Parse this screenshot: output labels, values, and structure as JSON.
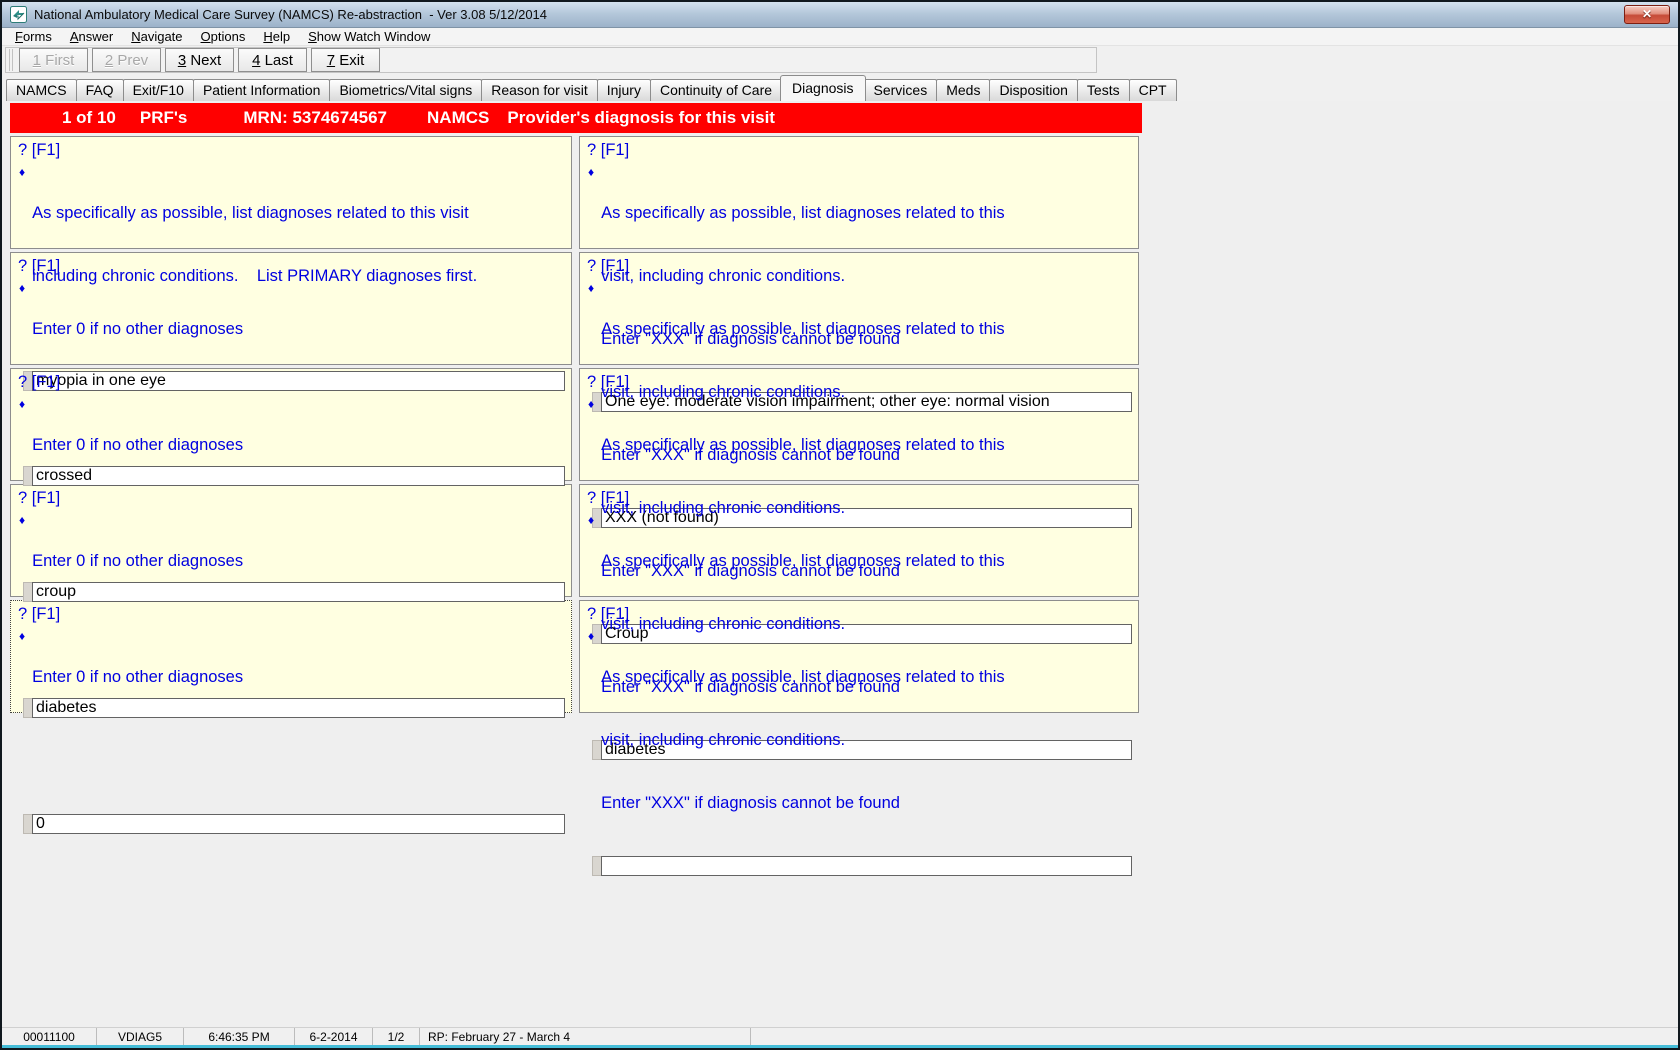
{
  "window": {
    "title": "National Ambulatory Medical Care Survey (NAMCS) Re-abstraction  - Ver 3.08 5/12/2014"
  },
  "icons": {
    "close": "✕",
    "bullet": "♦",
    "app": "app-logo"
  },
  "colors": {
    "banner_bg": "#FF0000",
    "banner_text": "#FFFFFF",
    "panel_bg": "#FFFFE1",
    "instruction_text": "#0000E0",
    "close_button": "#C64B38",
    "titlebar": "#B5C8DB"
  },
  "menu": {
    "items": [
      {
        "key": "F",
        "rest": "orms"
      },
      {
        "key": "A",
        "rest": "nswer"
      },
      {
        "key": "N",
        "rest": "avigate"
      },
      {
        "key": "O",
        "rest": "ptions"
      },
      {
        "key": "H",
        "rest": "elp"
      },
      {
        "key": "S",
        "rest": "how Watch Window"
      }
    ]
  },
  "toolbar": {
    "buttons": [
      {
        "key": "1",
        "rest": " First",
        "disabled": true
      },
      {
        "key": "2",
        "rest": " Prev",
        "disabled": true
      },
      {
        "key": "3",
        "rest": " Next",
        "disabled": false
      },
      {
        "key": "4",
        "rest": " Last",
        "disabled": false
      },
      {
        "key": "7",
        "rest": " Exit",
        "disabled": false
      }
    ]
  },
  "tabs": {
    "active": "Diagnosis",
    "items": [
      "NAMCS",
      "FAQ",
      "Exit/F10",
      "Patient Information",
      "Biometrics/Vital signs",
      "Reason for visit",
      "Injury",
      "Continuity of Care",
      "Diagnosis",
      "Services",
      "Meds",
      "Disposition",
      "Tests",
      "CPT"
    ]
  },
  "banner": {
    "position": "1 of 10",
    "group": "PRF's",
    "mrn": "MRN: 5374674567",
    "survey": "NAMCS",
    "title": "Provider's diagnosis for this visit"
  },
  "panels": {
    "left": [
      {
        "help": "? [F1]",
        "lines": [
          "As specifically as possible, list diagnoses related to this visit",
          "including chronic conditions.    List PRIMARY diagnoses first."
        ],
        "value": "myopia in one eye"
      },
      {
        "help": "? [F1]",
        "lines": [
          "Enter 0 if no other diagnoses"
        ],
        "value": "crossed"
      },
      {
        "help": "? [F1]",
        "lines": [
          "Enter 0 if no other diagnoses"
        ],
        "value": "croup"
      },
      {
        "help": "? [F1]",
        "lines": [
          "Enter 0 if no other diagnoses"
        ],
        "value": "diabetes"
      },
      {
        "help": "? [F1]",
        "lines": [
          "Enter 0 if no other diagnoses"
        ],
        "value": "0"
      }
    ],
    "right": [
      {
        "help": "? [F1]",
        "lines": [
          "As specifically as possible, list diagnoses related to this",
          "visit, including chronic conditions.",
          "Enter \"XXX\" if diagnosis cannot be found"
        ],
        "value": "One eye: moderate vision impairment; other eye: normal vision"
      },
      {
        "help": "? [F1]",
        "lines": [
          "As specifically as possible, list diagnoses related to this",
          "visit, including chronic conditions.",
          "Enter \"XXX\" if diagnosis cannot be found"
        ],
        "value": "XXX (not found)"
      },
      {
        "help": "? [F1]",
        "lines": [
          "As specifically as possible, list diagnoses related to this",
          "visit, including chronic conditions.",
          "Enter \"XXX\" if diagnosis cannot be found"
        ],
        "value": "Croup"
      },
      {
        "help": "? [F1]",
        "lines": [
          "As specifically as possible, list diagnoses related to this",
          "visit, including chronic conditions.",
          "Enter \"XXX\" if diagnosis cannot be found"
        ],
        "value": "diabetes"
      },
      {
        "help": "? [F1]",
        "lines": [
          "As specifically as possible, list diagnoses related to this",
          "visit, including chronic conditions.",
          "Enter \"XXX\" if diagnosis cannot be found"
        ],
        "value": ""
      }
    ]
  },
  "statusbar": {
    "cells": [
      "00011100",
      "VDIAG5",
      "6:46:35 PM",
      "6-2-2014",
      "1/2",
      "RP: February 27 - March 4"
    ]
  }
}
